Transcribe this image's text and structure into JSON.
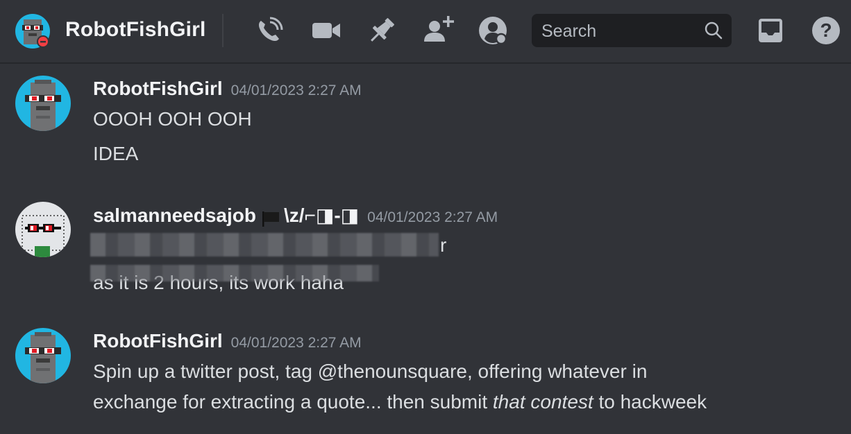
{
  "header": {
    "channel_title": "RobotFishGirl",
    "icons": [
      "phone-call-icon",
      "video-camera-icon",
      "pin-icon",
      "add-friend-icon",
      "user-profile-icon",
      "inbox-icon",
      "help-icon"
    ],
    "search": {
      "placeholder": "Search"
    }
  },
  "messages": [
    {
      "username": "RobotFishGirl",
      "timestamp": "04/01/2023 2:27 AM",
      "lines": [
        "OOOH OOH OOH",
        "IDEA"
      ]
    },
    {
      "username": "salmanneedsajob",
      "username_suffix": "\\z/⌐◨-◨",
      "timestamp": "04/01/2023 2:27 AM",
      "lines": [
        "r",
        "as it is 2 hours, its work haha"
      ]
    },
    {
      "username": "RobotFishGirl",
      "timestamp": "04/01/2023 2:27 AM",
      "line1": "Spin up a twitter post, tag @thenounsquare, offering whatever in",
      "line2_before": "exchange for extracting a quote... then submit ",
      "line2_em": "that contest",
      "line2_after": " to hackweek"
    }
  ],
  "colors": {
    "background": "#313338",
    "avatar_cyan": "#21b6e2",
    "text": "#dbdee1",
    "muted": "#949ba4"
  }
}
